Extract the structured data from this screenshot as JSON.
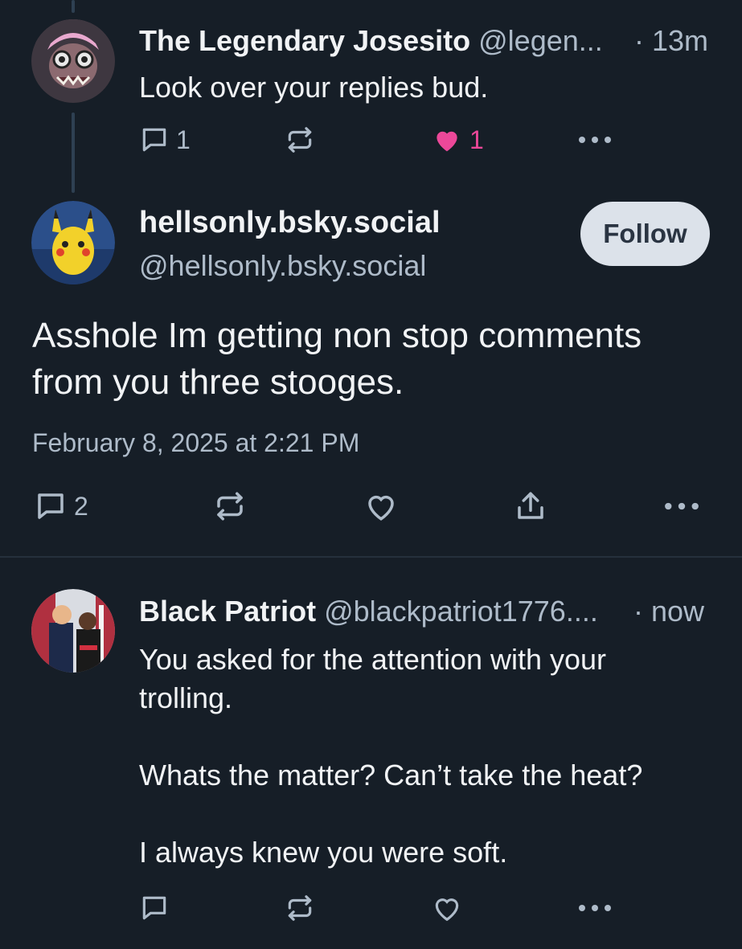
{
  "posts": [
    {
      "author_name": "The Legendary Josesito",
      "handle": "@legen...",
      "time": "· 13m",
      "text": "Look over your replies bud.",
      "reply_count": "1",
      "like_count": "1",
      "liked": true,
      "avatar_icon": "monster-mask-avatar"
    },
    {
      "author_name": "hellsonly.bsky.social",
      "handle": "@hellsonly.bsky.social",
      "follow_label": "Follow",
      "text_line1": "Asshole Im getting non stop comments",
      "text_line2": "from you three stooges.",
      "timestamp": "February 8, 2025 at 2:21 PM",
      "reply_count": "2",
      "avatar_icon": "pikachu-avatar"
    },
    {
      "author_name": "Black Patriot",
      "handle": "@blackpatriot1776....",
      "time": "· now",
      "text_line1": "You asked for the attention with your",
      "text_line2": "trolling.",
      "text_line3": "Whats the matter? Can’t take the heat?",
      "text_line4": "I always knew you were soft.",
      "avatar_icon": "photo-avatar"
    }
  ],
  "colors": {
    "background": "#161e27",
    "like_active": "#ec4899",
    "muted": "#aebbc9",
    "follow_bg": "#dce2ea"
  },
  "icons": [
    "reply-icon",
    "repost-icon",
    "heart-icon",
    "share-icon",
    "more-icon"
  ]
}
